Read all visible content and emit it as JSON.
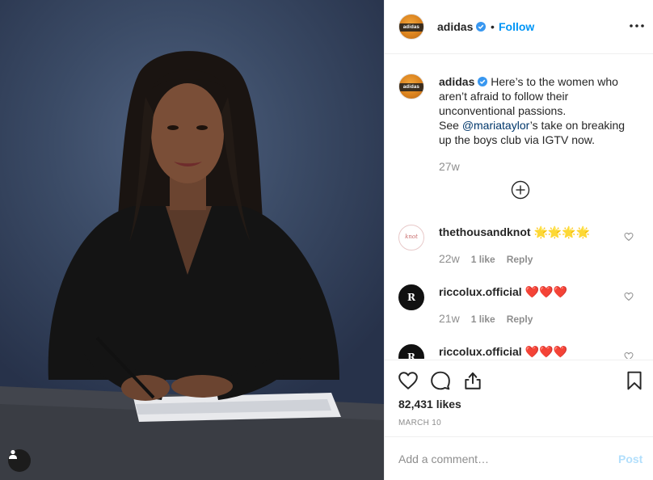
{
  "post": {
    "author": "adidas",
    "avatar_text": "adidas",
    "separator": "•",
    "follow_label": "Follow",
    "caption": {
      "user": "adidas",
      "text_before": "Here’s to the women who aren’t afraid to follow their unconventional passions.",
      "text_see": "See ",
      "mention": "@mariataylor",
      "text_after": "’s take on breaking up the boys club via IGTV now.",
      "age": "27w"
    },
    "comments": [
      {
        "user": "thethousandknot",
        "avatar_text": "knot",
        "text": "🌟🌟🌟🌟",
        "age": "22w",
        "likes": "1 like",
        "reply": "Reply"
      },
      {
        "user": "riccolux.official",
        "avatar_text": "R",
        "text": "❤️❤️❤️",
        "age": "21w",
        "likes": "1 like",
        "reply": "Reply"
      },
      {
        "user": "riccolux.official",
        "avatar_text": "R",
        "text": "❤️❤️❤️"
      }
    ],
    "likes_count": "82,431 likes",
    "date": "MARCH 10"
  },
  "add_comment": {
    "placeholder": "Add a comment…",
    "post_label": "Post"
  },
  "icons": {
    "verified": "verified-badge-icon",
    "more": "more-options-icon",
    "load_more": "load-more-comments-icon",
    "comment_like": "heart-outline-icon",
    "like": "heart-outline-icon",
    "comment": "comment-bubble-icon",
    "share": "share-icon",
    "save": "bookmark-icon",
    "tagged_users": "user-tag-icon"
  },
  "colors": {
    "accent": "#0095f6",
    "mention": "#00376b",
    "muted": "#8e8e8e",
    "border": "#efefef",
    "post_disabled": "#b2dffc"
  }
}
